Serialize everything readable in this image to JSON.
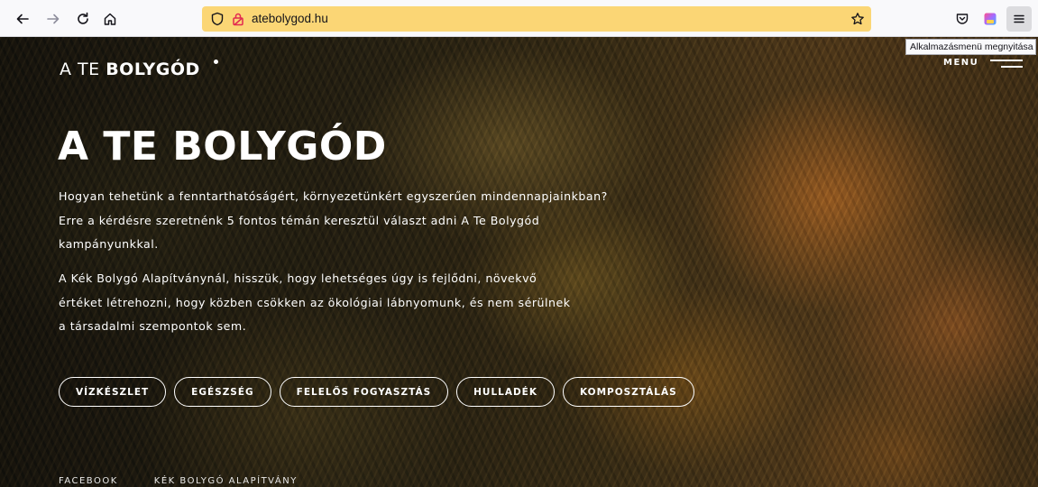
{
  "browser": {
    "url": "atebolygod.hu",
    "tooltip": "Alkalmazásmenü megnyitása",
    "icons": {
      "back": "arrow-left-icon",
      "forward": "arrow-right-icon",
      "reload": "reload-icon",
      "home": "home-icon",
      "shield": "shield-icon",
      "connection": "lock-icon",
      "bookmark": "star-icon",
      "pocket": "pocket-icon",
      "extension": "extension-icon",
      "menu": "hamburger-icon"
    },
    "urlbar_color": "#fbd675"
  },
  "site": {
    "logo_light": "A TE ",
    "logo_bold": "BOLYGÓD",
    "menu_label": "MENU",
    "title": "A TE BOLYGÓD",
    "paragraph1": "Hogyan tehetünk a fenntarthatóságért, környezetünkért egyszerűen mindennapjainkban? Erre a kérdésre szeretnénk 5 fontos témán keresztül választ adni A Te Bolygód kampányunkkal.",
    "paragraph2": "A Kék Bolygó Alapítványnál, hisszük, hogy lehetséges úgy is fejlődni, növekvő értéket létrehozni, hogy közben csökken az ökológiai lábnyomunk, és nem sérülnek a társadalmi szempontok sem.",
    "tags": [
      "VÍZKÉSZLET",
      "EGÉSZSÉG",
      "FELELŐS FOGYASZTÁS",
      "HULLADÉK",
      "KOMPOSZTÁLÁS"
    ],
    "footer_links": [
      "FACEBOOK",
      "KÉK BOLYGÓ ALAPÍTVÁNY"
    ]
  }
}
